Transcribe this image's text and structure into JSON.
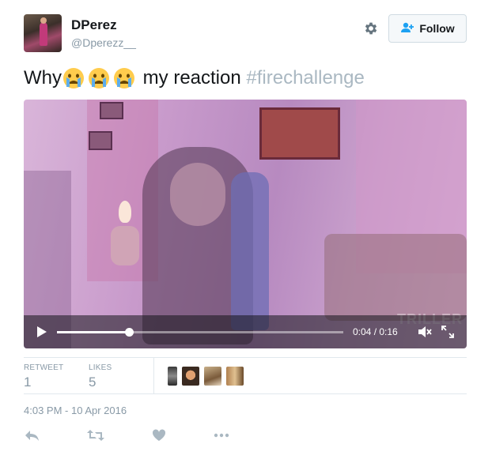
{
  "user": {
    "name": "DPerez",
    "handle": "@Dperezz__"
  },
  "follow_label": "Follow",
  "tweet": {
    "text_prefix": "Why",
    "emoji_count": 3,
    "text_middle": " my reaction ",
    "hashtag": "#firechallenge"
  },
  "video": {
    "timecode": "0:04 / 0:16",
    "progress": 0.25,
    "watermark": "TRILLER"
  },
  "stats": {
    "retweets_label": "RETWEET",
    "retweets": "1",
    "likes_label": "LIKES",
    "likes": "5"
  },
  "timestamp": "4:03 PM - 10 Apr 2016",
  "icons": {
    "settings": "gear-icon",
    "follow": "add-user-icon",
    "reply": "reply-icon",
    "retweet": "retweet-icon",
    "like": "heart-icon",
    "more": "more-icon"
  },
  "colors": {
    "hashtag": "#aab8c2",
    "secondary_text": "#8899a6",
    "follow_icon": "#1da1f2"
  }
}
